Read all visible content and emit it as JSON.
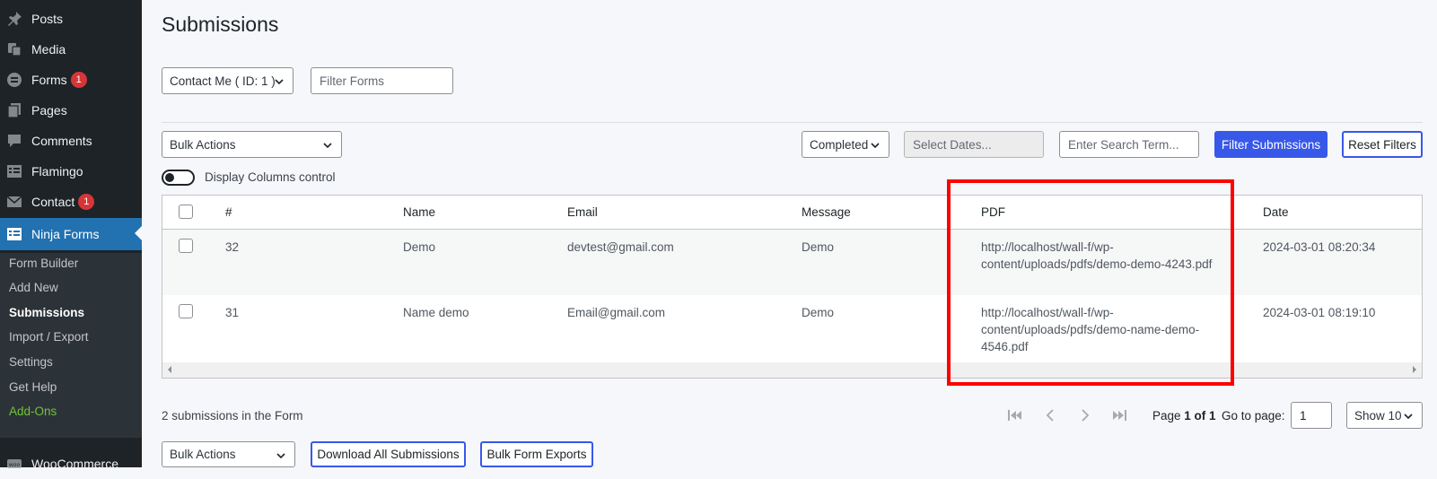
{
  "sidebar": {
    "items": [
      {
        "label": "Posts",
        "icon": "pin-icon"
      },
      {
        "label": "Media",
        "icon": "media-icon"
      },
      {
        "label": "Forms",
        "icon": "forms-icon",
        "badge": "1"
      },
      {
        "label": "Pages",
        "icon": "pages-icon"
      },
      {
        "label": "Comments",
        "icon": "comments-icon"
      },
      {
        "label": "Flamingo",
        "icon": "flamingo-icon"
      },
      {
        "label": "Contact",
        "icon": "mail-icon",
        "badge": "1"
      },
      {
        "label": "Ninja Forms",
        "icon": "ninja-forms-icon"
      }
    ],
    "submenu": [
      {
        "label": "Form Builder"
      },
      {
        "label": "Add New"
      },
      {
        "label": "Submissions"
      },
      {
        "label": "Import / Export"
      },
      {
        "label": "Settings"
      },
      {
        "label": "Get Help"
      },
      {
        "label": "Add-Ons"
      }
    ],
    "bottom_item": {
      "label": "WooCommerce",
      "icon": "woo-icon"
    }
  },
  "page": {
    "title": "Submissions"
  },
  "form_select": {
    "value": "Contact Me ( ID: 1 )"
  },
  "filter_forms": {
    "placeholder": "Filter Forms"
  },
  "bulk_actions": {
    "value": "Bulk Actions"
  },
  "status_select": {
    "value": "Completed"
  },
  "dates": {
    "placeholder": "Select Dates..."
  },
  "search": {
    "placeholder": "Enter Search Term..."
  },
  "filter_button": {
    "label": "Filter Submissions"
  },
  "reset_button": {
    "label": "Reset Filters"
  },
  "columns_toggle": {
    "label": "Display Columns control"
  },
  "table": {
    "headers": [
      "#",
      "Name",
      "Email",
      "Message",
      "PDF",
      "Date"
    ],
    "rows": [
      {
        "id": "32",
        "name": "Demo",
        "email": "devtest@gmail.com",
        "message": "Demo",
        "pdf_line1": "http://localhost/wall-f/wp-",
        "pdf_line2": "content/uploads/pdfs/demo-demo-4243.pdf",
        "pdf_line3": "",
        "date": "2024-03-01 08:20:34"
      },
      {
        "id": "31",
        "name": "Name demo",
        "email": "Email@gmail.com",
        "message": "Demo",
        "pdf_line1": "http://localhost/wall-f/wp-",
        "pdf_line2": "content/uploads/pdfs/demo-name-demo-",
        "pdf_line3": "4546.pdf",
        "date": "2024-03-01 08:19:10"
      }
    ]
  },
  "footer": {
    "count_text": "2 submissions in the Form",
    "page_prefix": "Page ",
    "page_current": "1 of 1",
    "goto_label": "Go to page:",
    "goto_value": "1",
    "show_value": "Show 10",
    "bulk_actions": "Bulk Actions",
    "download_all": "Download All Submissions",
    "bulk_exports": "Bulk Form Exports"
  },
  "colors": {
    "sidebar_bg": "#1d2327",
    "active": "#2271b1",
    "primary_button": "#3858e9",
    "badge": "#d63638",
    "highlight": "#ff0000",
    "addons": "#72c33a"
  }
}
